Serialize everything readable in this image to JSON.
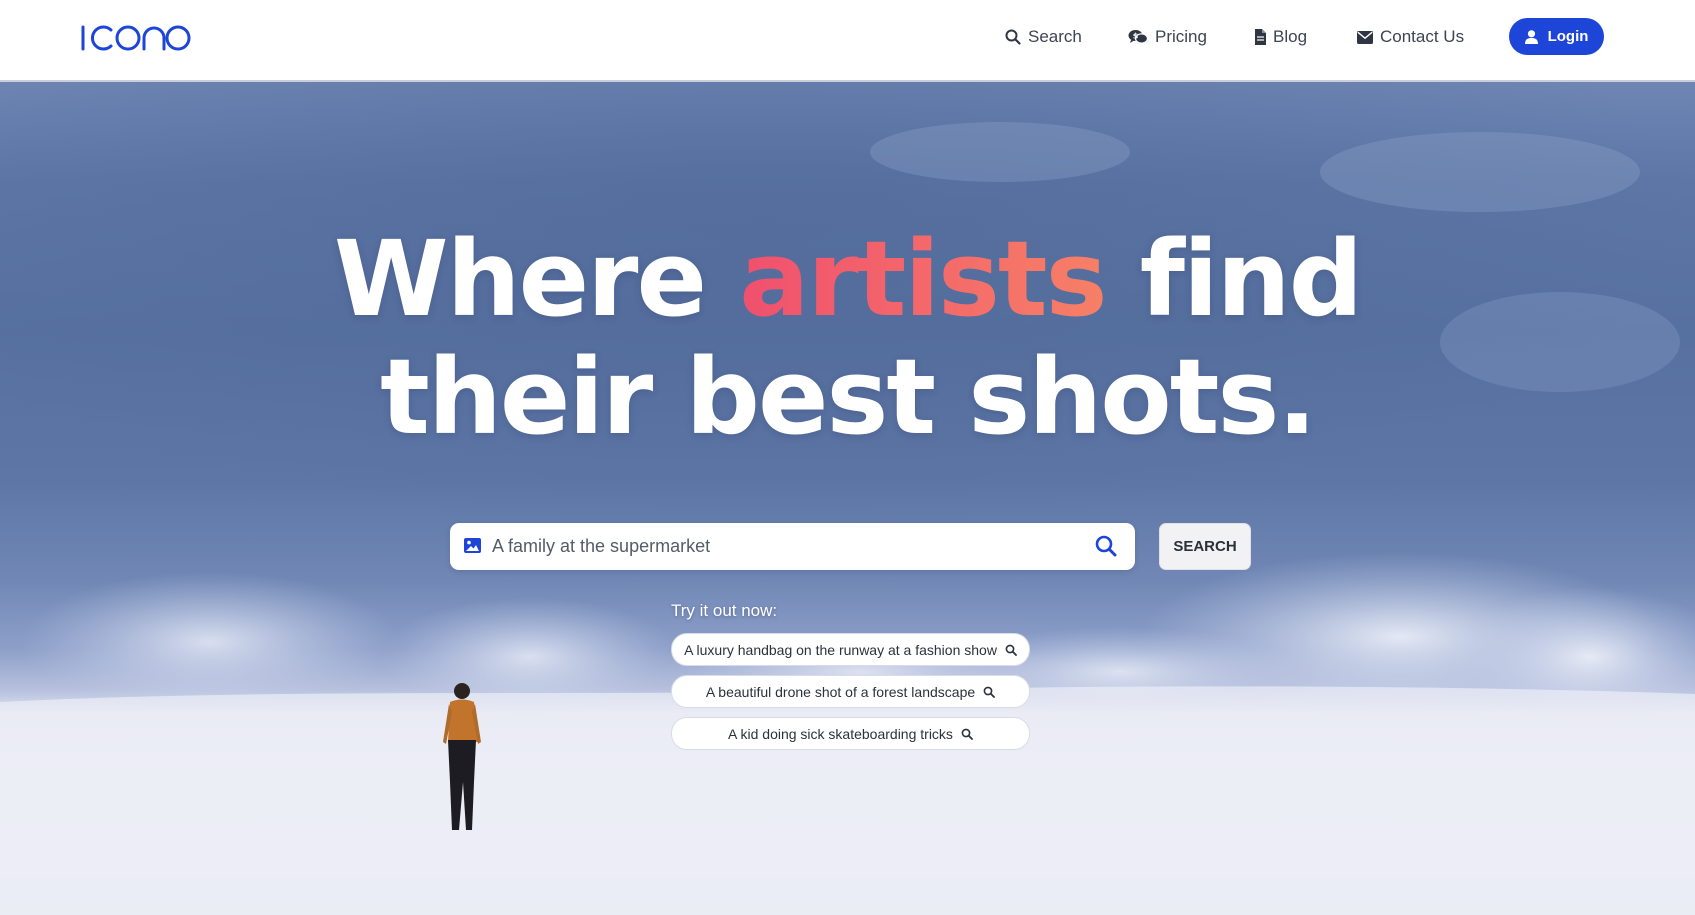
{
  "brand": {
    "name": "ICONO",
    "color": "#1d45d8"
  },
  "nav": {
    "items": [
      {
        "label": "Search",
        "icon": "search-icon"
      },
      {
        "label": "Pricing",
        "icon": "comments-dollar-icon"
      },
      {
        "label": "Blog",
        "icon": "file-icon"
      },
      {
        "label": "Contact Us",
        "icon": "envelope-icon"
      }
    ],
    "login": {
      "label": "Login",
      "icon": "user-icon"
    }
  },
  "hero": {
    "headline_pre": "Where ",
    "headline_accent": "artists",
    "headline_post": " find",
    "headline_line2": "their best shots.",
    "accent_colors": [
      "#f0506e",
      "#f78066"
    ]
  },
  "search": {
    "value": "A family at the supermarket",
    "button_label": "SEARCH"
  },
  "try": {
    "label": "Try it out now:",
    "suggestions": [
      "A luxury handbag on the runway at a fashion show",
      "A beautiful drone shot of a forest landscape",
      "A kid doing sick skateboarding tricks"
    ]
  }
}
